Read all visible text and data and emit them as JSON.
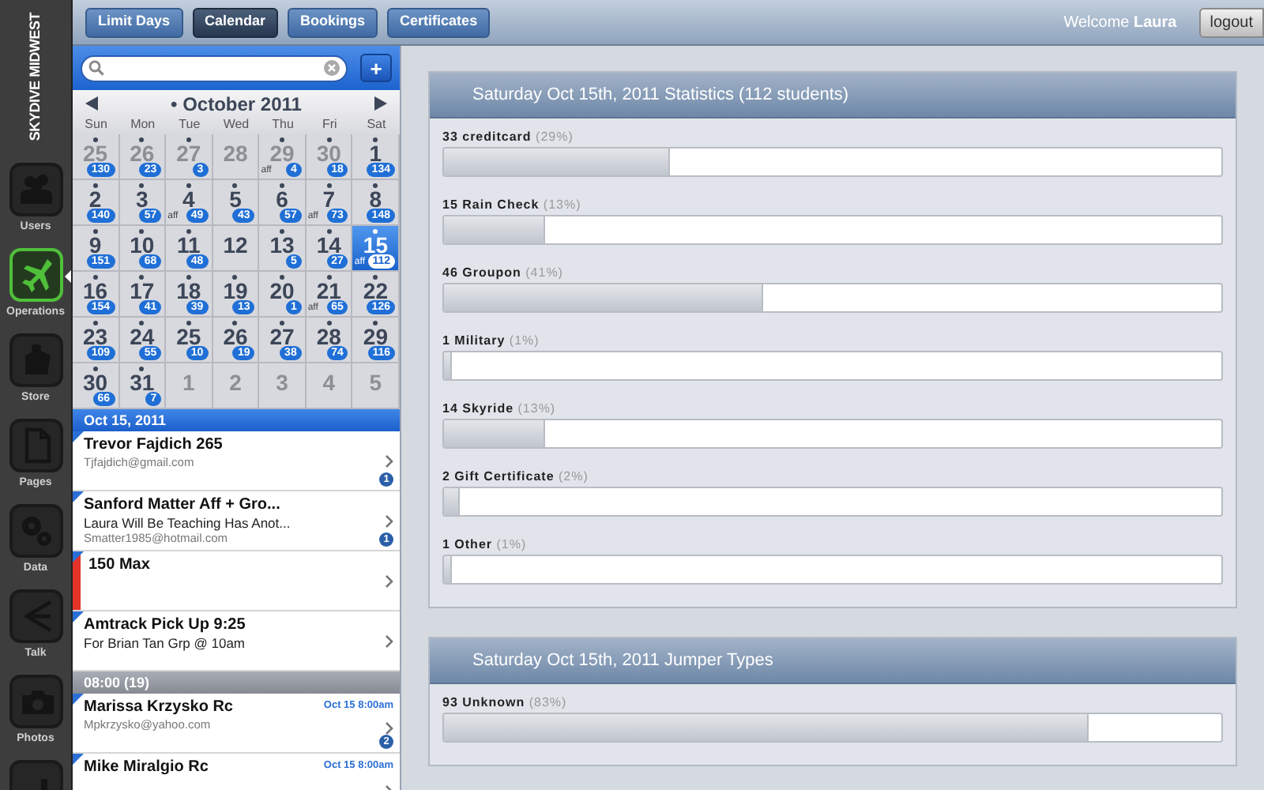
{
  "brand": "SKYDIVE MIDWEST",
  "sidebar": {
    "items": [
      {
        "kind": "users",
        "label": "Users",
        "selected": false
      },
      {
        "kind": "plane",
        "label": "Operations",
        "selected": true
      },
      {
        "kind": "store",
        "label": "Store",
        "selected": false
      },
      {
        "kind": "pages",
        "label": "Pages",
        "selected": false
      },
      {
        "kind": "gears",
        "label": "Data",
        "selected": false
      },
      {
        "kind": "talk",
        "label": "Talk",
        "selected": false
      },
      {
        "kind": "camera",
        "label": "Photos",
        "selected": false
      },
      {
        "kind": "partial",
        "selected": false
      }
    ]
  },
  "tabs": [
    {
      "label": "Limit Days",
      "selected": false
    },
    {
      "label": "Calendar",
      "selected": true
    },
    {
      "label": "Bookings",
      "selected": false
    },
    {
      "label": "Certificates",
      "selected": false
    }
  ],
  "welcome": "Welcome **Laura**",
  "logout": "logout",
  "add_button": "+",
  "calendar": {
    "title": "• October 2011",
    "weekdays": [
      "Sun",
      "Mon",
      "Tue",
      "Wed",
      "Thu",
      "Fri",
      "Sat"
    ],
    "days": [
      {
        "day": "25",
        "other_month": true,
        "dot": true,
        "count": "130",
        "selected": false
      },
      {
        "day": "26",
        "other_month": true,
        "dot": true,
        "count": "23",
        "selected": false
      },
      {
        "day": "27",
        "other_month": true,
        "dot": true,
        "count": "3",
        "selected": false
      },
      {
        "day": "28",
        "other_month": true,
        "dot": false,
        "selected": false
      },
      {
        "day": "29",
        "other_month": true,
        "dot": true,
        "aff": "aff",
        "count": "4",
        "selected": false
      },
      {
        "day": "30",
        "other_month": true,
        "dot": true,
        "count": "18",
        "selected": false
      },
      {
        "day": "1",
        "other_month": false,
        "dot": true,
        "count": "134",
        "selected": false
      },
      {
        "day": "2",
        "other_month": false,
        "dot": true,
        "count": "140",
        "selected": false
      },
      {
        "day": "3",
        "other_month": false,
        "dot": true,
        "count": "57",
        "selected": false
      },
      {
        "day": "4",
        "other_month": false,
        "dot": true,
        "aff": "aff",
        "count": "49",
        "selected": false
      },
      {
        "day": "5",
        "other_month": false,
        "dot": true,
        "count": "43",
        "selected": false
      },
      {
        "day": "6",
        "other_month": false,
        "dot": true,
        "count": "57",
        "selected": false
      },
      {
        "day": "7",
        "other_month": false,
        "dot": true,
        "aff": "aff",
        "count": "73",
        "selected": false
      },
      {
        "day": "8",
        "other_month": false,
        "dot": true,
        "count": "148",
        "selected": false
      },
      {
        "day": "9",
        "other_month": false,
        "dot": true,
        "count": "151",
        "selected": false
      },
      {
        "day": "10",
        "other_month": false,
        "dot": true,
        "count": "68",
        "selected": false
      },
      {
        "day": "11",
        "other_month": false,
        "dot": true,
        "count": "48",
        "selected": false
      },
      {
        "day": "12",
        "other_month": false,
        "dot": false,
        "selected": false
      },
      {
        "day": "13",
        "other_month": false,
        "dot": true,
        "count": "5",
        "selected": false
      },
      {
        "day": "14",
        "other_month": false,
        "dot": true,
        "count": "27",
        "selected": false
      },
      {
        "day": "15",
        "other_month": false,
        "dot": true,
        "aff": "aff",
        "count": "112",
        "selected": true
      },
      {
        "day": "16",
        "other_month": false,
        "dot": true,
        "count": "154",
        "selected": false
      },
      {
        "day": "17",
        "other_month": false,
        "dot": true,
        "count": "41",
        "selected": false
      },
      {
        "day": "18",
        "other_month": false,
        "dot": true,
        "count": "39",
        "selected": false
      },
      {
        "day": "19",
        "other_month": false,
        "dot": true,
        "count": "13",
        "selected": false
      },
      {
        "day": "20",
        "other_month": false,
        "dot": true,
        "count": "1",
        "selected": false
      },
      {
        "day": "21",
        "other_month": false,
        "dot": true,
        "aff": "aff",
        "count": "65",
        "selected": false
      },
      {
        "day": "22",
        "other_month": false,
        "dot": true,
        "count": "126",
        "selected": false
      },
      {
        "day": "23",
        "other_month": false,
        "dot": true,
        "count": "109",
        "selected": false
      },
      {
        "day": "24",
        "other_month": false,
        "dot": true,
        "count": "55",
        "selected": false
      },
      {
        "day": "25",
        "other_month": false,
        "dot": true,
        "count": "10",
        "selected": false
      },
      {
        "day": "26",
        "other_month": false,
        "dot": true,
        "count": "19",
        "selected": false
      },
      {
        "day": "27",
        "other_month": false,
        "dot": true,
        "count": "38",
        "selected": false
      },
      {
        "day": "28",
        "other_month": false,
        "dot": true,
        "count": "74",
        "selected": false
      },
      {
        "day": "29",
        "other_month": false,
        "dot": true,
        "count": "116",
        "selected": false
      },
      {
        "day": "30",
        "other_month": false,
        "dot": true,
        "count": "66",
        "selected": false
      },
      {
        "day": "31",
        "other_month": false,
        "dot": true,
        "count": "7",
        "selected": false
      },
      {
        "day": "1",
        "other_month": true,
        "dot": false,
        "selected": false
      },
      {
        "day": "2",
        "other_month": true,
        "dot": false,
        "selected": false
      },
      {
        "day": "3",
        "other_month": true,
        "dot": false,
        "selected": false
      },
      {
        "day": "4",
        "other_month": true,
        "dot": false,
        "selected": false
      },
      {
        "day": "5",
        "other_month": true,
        "dot": false,
        "selected": false
      }
    ]
  },
  "agenda": [
    {
      "kind": "header",
      "title": "Oct 15, 2011"
    },
    {
      "kind": "item",
      "title": "Trevor Fajdich 265",
      "email": "Tjfajdich@gmail.com",
      "count": "1"
    },
    {
      "kind": "item",
      "title": "Sanford Matter Aff + Gro...",
      "note": "Laura Will Be Teaching Has Anot...",
      "email": "Smatter1985@hotmail.com",
      "count": "1"
    },
    {
      "kind": "item",
      "title": "150 Max",
      "color": "#e5332a"
    },
    {
      "kind": "item",
      "title": "Amtrack Pick Up 9:25",
      "note": "For Brian Tan Grp @ 10am"
    },
    {
      "kind": "header",
      "title": "08:00 (19)"
    },
    {
      "kind": "item",
      "title": "Marissa Krzysko Rc",
      "email": "Mpkrzysko@yahoo.com",
      "time": "Oct 15 8:00am",
      "count": "2"
    },
    {
      "kind": "item",
      "title": "Mike Miralgio Rc",
      "time": "Oct 15 8:00am"
    }
  ],
  "panels": [
    {
      "title": "Saturday Oct 15th, 2011 Statistics (112 students)",
      "bars": [
        {
          "label": "33 creditcard",
          "percent": "(29%)",
          "level": 0.29
        },
        {
          "label": "15 Rain Check",
          "percent": "(13%)",
          "level": 0.13
        },
        {
          "label": "46 Groupon",
          "percent": "(41%)",
          "level": 0.41
        },
        {
          "label": "1 Military",
          "percent": "(1%)",
          "level": 0.01
        },
        {
          "label": "14 Skyride",
          "percent": "(13%)",
          "level": 0.13
        },
        {
          "label": "2 Gift Certificate",
          "percent": "(2%)",
          "level": 0.02
        },
        {
          "label": "1 Other",
          "percent": "(1%)",
          "level": 0.01
        }
      ]
    },
    {
      "title": "Saturday Oct 15th, 2011 Jumper Types",
      "bars": [
        {
          "label": "93 Unknown",
          "percent": "(83%)",
          "level": 0.83
        }
      ]
    }
  ]
}
